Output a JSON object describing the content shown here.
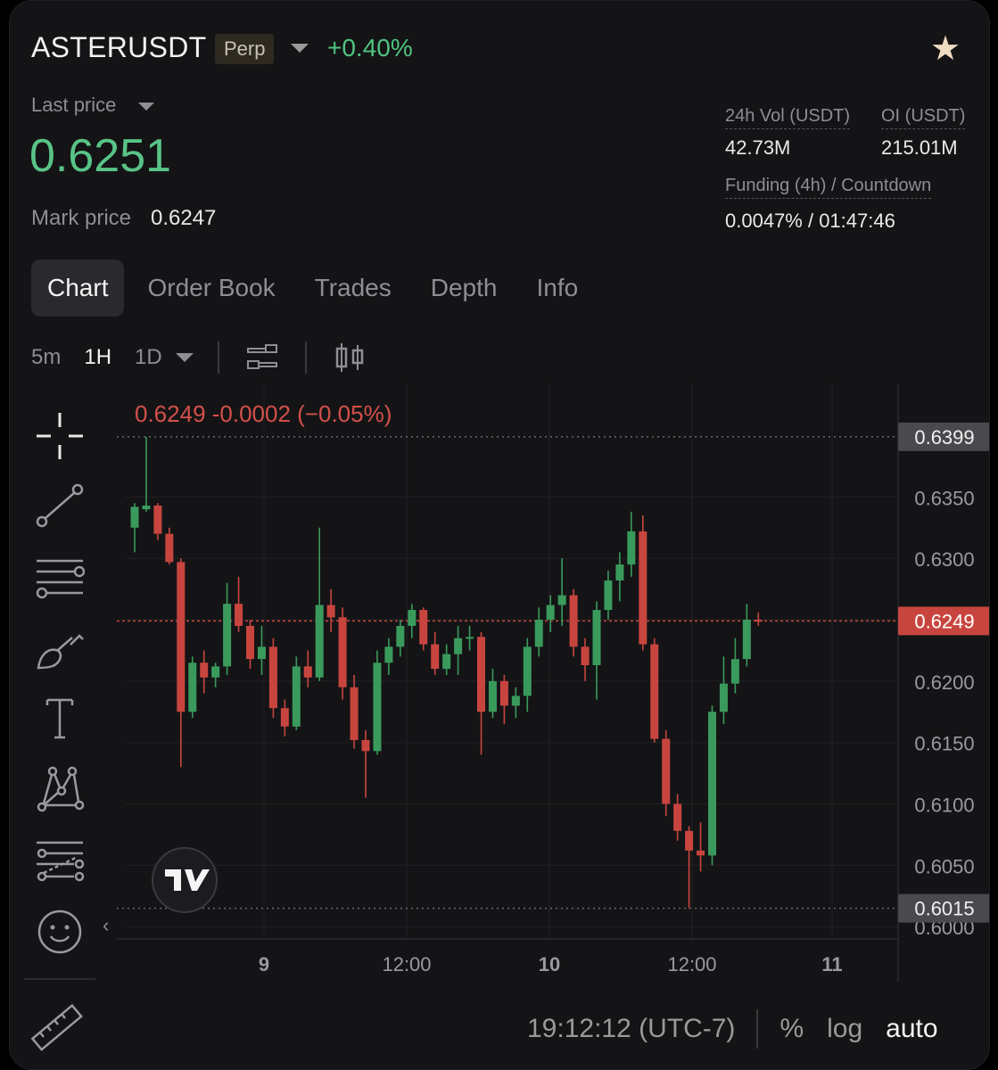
{
  "header": {
    "symbol": "ASTERUSDT",
    "badge": "Perp",
    "change": "+0.40%",
    "favorite_icon": "star-icon"
  },
  "price": {
    "last_label": "Last price",
    "last_value": "0.6251",
    "mark_label": "Mark price",
    "mark_value": "0.6247"
  },
  "stats": {
    "vol_label": "24h Vol (USDT)",
    "vol_value": "42.73M",
    "oi_label": "OI (USDT)",
    "oi_value": "215.01M",
    "funding_label": "Funding (4h) / Countdown",
    "funding_value": "0.0047% / 01:47:46"
  },
  "tabs": [
    "Chart",
    "Order Book",
    "Trades",
    "Depth",
    "Info"
  ],
  "active_tab": "Chart",
  "intervals": [
    "5m",
    "1H",
    "1D"
  ],
  "active_interval": "1H",
  "chart_ohlc": "0.6249  -0.0002 (−0.05%)",
  "footer": {
    "time": "19:12:12 (UTC-7)",
    "options": [
      "%",
      "log",
      "auto"
    ],
    "active_option": "auto"
  },
  "colors": {
    "up": "#3a9a5c",
    "down": "#c8453f",
    "price_green": "#59c487",
    "current_price_tag": "#c8453f"
  },
  "chart_data": {
    "type": "candlestick",
    "x_ticks": [
      "9",
      "12:00",
      "10",
      "12:00",
      "11"
    ],
    "y_ticks": [
      0.6,
      0.605,
      0.61,
      0.615,
      0.62,
      0.625,
      0.63,
      0.635
    ],
    "y_range": [
      0.599,
      0.642
    ],
    "high_marker": "0.6399",
    "low_marker": "0.6015",
    "current_marker": "0.6249",
    "candles": [
      {
        "o": 0.6325,
        "h": 0.6345,
        "l": 0.6305,
        "c": 0.6342
      },
      {
        "o": 0.634,
        "h": 0.6399,
        "l": 0.6338,
        "c": 0.6343
      },
      {
        "o": 0.6343,
        "h": 0.6345,
        "l": 0.6315,
        "c": 0.632
      },
      {
        "o": 0.632,
        "h": 0.6325,
        "l": 0.6295,
        "c": 0.6297
      },
      {
        "o": 0.6297,
        "h": 0.63,
        "l": 0.613,
        "c": 0.6175
      },
      {
        "o": 0.6175,
        "h": 0.622,
        "l": 0.617,
        "c": 0.6215
      },
      {
        "o": 0.6215,
        "h": 0.6225,
        "l": 0.619,
        "c": 0.6203
      },
      {
        "o": 0.6203,
        "h": 0.6215,
        "l": 0.6195,
        "c": 0.6212
      },
      {
        "o": 0.6212,
        "h": 0.628,
        "l": 0.6205,
        "c": 0.6263
      },
      {
        "o": 0.6263,
        "h": 0.6285,
        "l": 0.624,
        "c": 0.6245
      },
      {
        "o": 0.6245,
        "h": 0.625,
        "l": 0.621,
        "c": 0.6218
      },
      {
        "o": 0.6218,
        "h": 0.6245,
        "l": 0.6205,
        "c": 0.6228
      },
      {
        "o": 0.6228,
        "h": 0.6235,
        "l": 0.617,
        "c": 0.6178
      },
      {
        "o": 0.6178,
        "h": 0.6185,
        "l": 0.6155,
        "c": 0.6163
      },
      {
        "o": 0.6163,
        "h": 0.622,
        "l": 0.616,
        "c": 0.6212
      },
      {
        "o": 0.6212,
        "h": 0.6225,
        "l": 0.6195,
        "c": 0.6203
      },
      {
        "o": 0.6203,
        "h": 0.6325,
        "l": 0.62,
        "c": 0.6262
      },
      {
        "o": 0.6262,
        "h": 0.6275,
        "l": 0.624,
        "c": 0.6252
      },
      {
        "o": 0.6252,
        "h": 0.626,
        "l": 0.6185,
        "c": 0.6195
      },
      {
        "o": 0.6195,
        "h": 0.6205,
        "l": 0.6145,
        "c": 0.6152
      },
      {
        "o": 0.6152,
        "h": 0.616,
        "l": 0.6105,
        "c": 0.6143
      },
      {
        "o": 0.6143,
        "h": 0.6225,
        "l": 0.614,
        "c": 0.6215
      },
      {
        "o": 0.6215,
        "h": 0.6235,
        "l": 0.6205,
        "c": 0.6228
      },
      {
        "o": 0.6228,
        "h": 0.625,
        "l": 0.622,
        "c": 0.6245
      },
      {
        "o": 0.6245,
        "h": 0.6263,
        "l": 0.6235,
        "c": 0.6258
      },
      {
        "o": 0.6258,
        "h": 0.626,
        "l": 0.6225,
        "c": 0.623
      },
      {
        "o": 0.623,
        "h": 0.624,
        "l": 0.6205,
        "c": 0.621
      },
      {
        "o": 0.621,
        "h": 0.623,
        "l": 0.6205,
        "c": 0.6222
      },
      {
        "o": 0.6222,
        "h": 0.6245,
        "l": 0.6205,
        "c": 0.6235
      },
      {
        "o": 0.6235,
        "h": 0.6245,
        "l": 0.6225,
        "c": 0.6236
      },
      {
        "o": 0.6236,
        "h": 0.624,
        "l": 0.614,
        "c": 0.6175
      },
      {
        "o": 0.6175,
        "h": 0.621,
        "l": 0.617,
        "c": 0.62
      },
      {
        "o": 0.62,
        "h": 0.6205,
        "l": 0.6165,
        "c": 0.618
      },
      {
        "o": 0.618,
        "h": 0.6195,
        "l": 0.617,
        "c": 0.6188
      },
      {
        "o": 0.6188,
        "h": 0.6235,
        "l": 0.6175,
        "c": 0.6228
      },
      {
        "o": 0.6228,
        "h": 0.626,
        "l": 0.622,
        "c": 0.625
      },
      {
        "o": 0.625,
        "h": 0.627,
        "l": 0.624,
        "c": 0.6262
      },
      {
        "o": 0.6262,
        "h": 0.63,
        "l": 0.6245,
        "c": 0.627
      },
      {
        "o": 0.627,
        "h": 0.6275,
        "l": 0.622,
        "c": 0.6228
      },
      {
        "o": 0.6228,
        "h": 0.6235,
        "l": 0.62,
        "c": 0.6213
      },
      {
        "o": 0.6213,
        "h": 0.6265,
        "l": 0.6185,
        "c": 0.6258
      },
      {
        "o": 0.6258,
        "h": 0.629,
        "l": 0.625,
        "c": 0.6282
      },
      {
        "o": 0.6282,
        "h": 0.6305,
        "l": 0.6265,
        "c": 0.6295
      },
      {
        "o": 0.6295,
        "h": 0.6338,
        "l": 0.6285,
        "c": 0.6322
      },
      {
        "o": 0.6322,
        "h": 0.6335,
        "l": 0.6225,
        "c": 0.623
      },
      {
        "o": 0.623,
        "h": 0.6235,
        "l": 0.615,
        "c": 0.6153
      },
      {
        "o": 0.6153,
        "h": 0.616,
        "l": 0.609,
        "c": 0.61
      },
      {
        "o": 0.61,
        "h": 0.6108,
        "l": 0.607,
        "c": 0.6078
      },
      {
        "o": 0.6078,
        "h": 0.6082,
        "l": 0.6015,
        "c": 0.6062
      },
      {
        "o": 0.6062,
        "h": 0.6085,
        "l": 0.6045,
        "c": 0.6058
      },
      {
        "o": 0.6058,
        "h": 0.618,
        "l": 0.605,
        "c": 0.6175
      },
      {
        "o": 0.6175,
        "h": 0.622,
        "l": 0.6165,
        "c": 0.6198
      },
      {
        "o": 0.6198,
        "h": 0.6235,
        "l": 0.619,
        "c": 0.6218
      },
      {
        "o": 0.6218,
        "h": 0.6263,
        "l": 0.6212,
        "c": 0.625
      },
      {
        "o": 0.625,
        "h": 0.6256,
        "l": 0.6245,
        "c": 0.6249
      }
    ]
  }
}
